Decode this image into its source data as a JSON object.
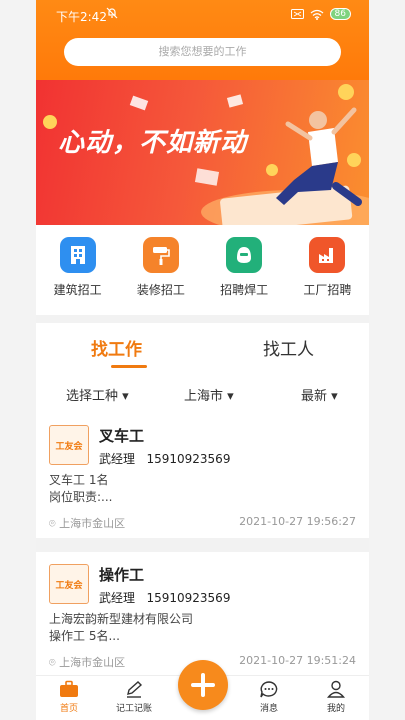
{
  "status": {
    "time": "下午2:42",
    "battery": "86"
  },
  "search": {
    "placeholder": "搜索您想要的工作"
  },
  "banner": {
    "slogan": "心动，不如新动"
  },
  "quick": [
    {
      "label": "建筑招工",
      "color": "#2e8ff0"
    },
    {
      "label": "装修招工",
      "color": "#f5832a"
    },
    {
      "label": "招聘焊工",
      "color": "#22b07a"
    },
    {
      "label": "工厂招聘",
      "color": "#f0562a"
    }
  ],
  "tabs": {
    "find_job": "找工作",
    "find_worker": "找工人"
  },
  "filters": {
    "type": "选择工种",
    "city": "上海市",
    "sort": "最新"
  },
  "jobs": [
    {
      "logo": "工友会",
      "title": "叉车工",
      "contact": "武经理",
      "phone": "15910923569",
      "line1": "叉车工 1名",
      "line2": "岗位职责:...",
      "location": "上海市金山区",
      "date": "2021-10-27 19:56:27"
    },
    {
      "logo": "工友会",
      "title": "操作工",
      "contact": "武经理",
      "phone": "15910923569",
      "line1": "上海宏韵新型建材有限公司",
      "line2": "操作工 5名...",
      "location": "上海市金山区",
      "date": "2021-10-27 19:51:24"
    }
  ],
  "nav": {
    "home": "首页",
    "ledger": "记工记账",
    "messages": "消息",
    "mine": "我的"
  },
  "colors": {
    "accent": "#f07a10"
  }
}
